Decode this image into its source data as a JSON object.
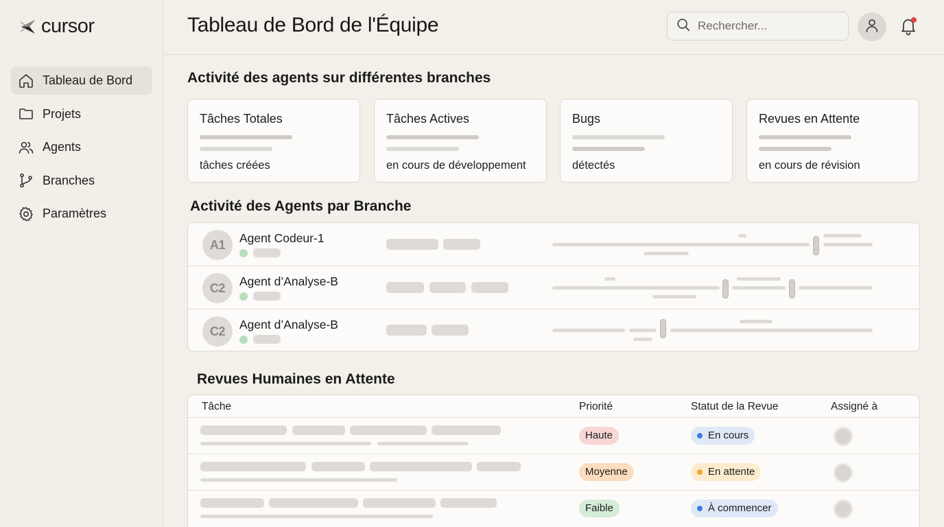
{
  "brand": {
    "name": "cursor"
  },
  "sidebar": {
    "items": [
      {
        "label": "Tableau de Bord",
        "icon": "home-icon",
        "active": true
      },
      {
        "label": "Projets",
        "icon": "folder-icon",
        "active": false
      },
      {
        "label": "Agents",
        "icon": "users-icon",
        "active": false
      },
      {
        "label": "Branches",
        "icon": "git-branch-icon",
        "active": false
      },
      {
        "label": "Paramètres",
        "icon": "gear-icon",
        "active": false
      }
    ]
  },
  "header": {
    "title": "Tableau de Bord de l'Équipe",
    "search_placeholder": "Rechercher...",
    "notification_dot_color": "#e04444"
  },
  "overview": {
    "title": "Activité des agents sur différentes branches",
    "cards": [
      {
        "label": "Tâches Totales",
        "sub": "tâches créées"
      },
      {
        "label": "Tâches Actives",
        "sub": "en cours de développement"
      },
      {
        "label": "Bugs",
        "sub": "détectés"
      },
      {
        "label": "Revues en Attente",
        "sub": "en cours de révision"
      }
    ]
  },
  "agents": {
    "title": "Activité des Agents par Branche",
    "rows": [
      {
        "initials": "A1",
        "name": "Agent Codeur-1"
      },
      {
        "initials": "C2",
        "name": "Agent d’Analyse-B"
      },
      {
        "initials": "C2",
        "name": "Agent d’Analyse-B"
      }
    ]
  },
  "reviews": {
    "title": "Revues Humaines en Attente",
    "columns": [
      "Tâche",
      "Priorité",
      "Statut de la Revue",
      "Assigné à"
    ],
    "rows": [
      {
        "priority": "Haute",
        "status": "En cours",
        "status_color": "#3b7ddd"
      },
      {
        "priority": "Moyenne",
        "status": "En attente",
        "status_color": "#f5a623"
      },
      {
        "priority": "Faible",
        "status": "À commencer",
        "status_color": "#3b7ddd"
      }
    ]
  }
}
